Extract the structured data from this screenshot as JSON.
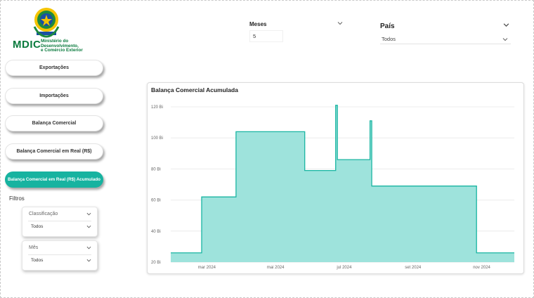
{
  "brand": {
    "name": "MDIC",
    "subtitle_lines": [
      "Ministério do",
      "Desenvolvimento,",
      "e Comércio Exterior"
    ]
  },
  "nav": {
    "items": [
      {
        "label": "Exportações",
        "active": false
      },
      {
        "label": "Importações",
        "active": false
      },
      {
        "label": "Balança Comercial",
        "active": false
      },
      {
        "label": "Balança Comercial em Real (R$)",
        "active": false
      },
      {
        "label": "Balança Comercial em Real (R$) Acumulado",
        "active": true
      }
    ]
  },
  "filters": {
    "label": "Filtros",
    "classificacao": {
      "title": "Classificação",
      "value": "Todos"
    },
    "mes": {
      "title": "Mês",
      "value": "Todos"
    }
  },
  "meses": {
    "label": "Meses",
    "value": "5"
  },
  "pais": {
    "label": "País",
    "value": "Todos"
  },
  "colors": {
    "accent": "#17b3a0",
    "area_fill": "#9ee3dc",
    "line": "#19b5a2"
  },
  "chart_data": {
    "type": "area",
    "title": "Balança Comercial Acumulada",
    "y_ticks": [
      "20 Bi",
      "40 Bi",
      "60 Bi",
      "80 Bi",
      "100 Bi",
      "120 Bi"
    ],
    "x_ticks": [
      "mar 2024",
      "mai 2024",
      "jul 2024",
      "set 2024",
      "nov 2024"
    ],
    "ylim": [
      20,
      120
    ],
    "xlim": [
      0,
      10
    ],
    "grid": true,
    "points": [
      [
        0,
        26
      ],
      [
        0.9,
        26
      ],
      [
        0.9,
        62
      ],
      [
        1.9,
        62
      ],
      [
        1.9,
        104
      ],
      [
        3.9,
        104
      ],
      [
        3.9,
        79
      ],
      [
        4.8,
        79
      ],
      [
        4.8,
        121
      ],
      [
        4.85,
        121
      ],
      [
        4.85,
        86
      ],
      [
        5.8,
        86
      ],
      [
        5.8,
        111
      ],
      [
        5.85,
        111
      ],
      [
        5.85,
        69
      ],
      [
        8.9,
        69
      ],
      [
        8.9,
        26
      ],
      [
        10,
        26
      ]
    ]
  }
}
